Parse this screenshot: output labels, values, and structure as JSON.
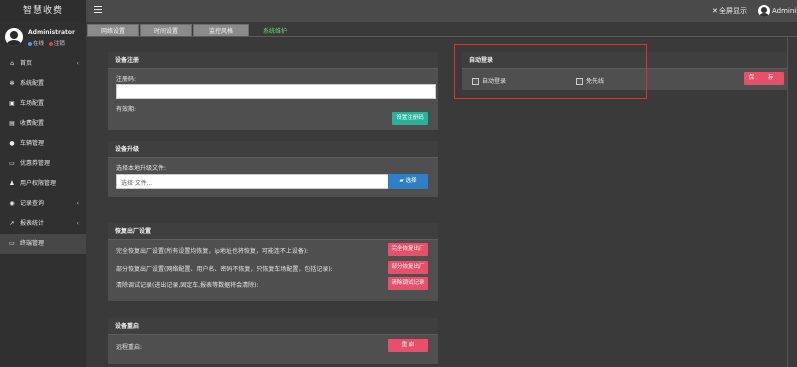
{
  "topbar": {
    "brand": "智慧收费",
    "fullscreen_label": "全屏显示",
    "user_name": "Adminis"
  },
  "sidebar": {
    "user_name": "Administrator",
    "status_online": "在线",
    "status_logout": "注销",
    "items": [
      {
        "label": "首页",
        "icon": "home-icon",
        "chevron": "‹"
      },
      {
        "label": "系统配置",
        "icon": "gear-icon",
        "chevron": ""
      },
      {
        "label": "车场配置",
        "icon": "parking-icon",
        "chevron": ""
      },
      {
        "label": "收费配置",
        "icon": "money-icon",
        "chevron": ""
      },
      {
        "label": "车辆管理",
        "icon": "car-icon",
        "chevron": ""
      },
      {
        "label": "优惠券管理",
        "icon": "coupon-icon",
        "chevron": ""
      },
      {
        "label": "用户权限管理",
        "icon": "users-icon",
        "chevron": ""
      },
      {
        "label": "记录查询",
        "icon": "search-icon",
        "chevron": "‹"
      },
      {
        "label": "报表统计",
        "icon": "chart-icon",
        "chevron": "‹"
      },
      {
        "label": "终端管理",
        "icon": "monitor-icon",
        "chevron": ""
      }
    ]
  },
  "tabs": [
    "网络设置",
    "时间设置",
    "监控风格",
    "系统维护"
  ],
  "register": {
    "title": "设备注册",
    "code_label": "注册码:",
    "code_value": "",
    "validity_label": "有效期:",
    "button": "设置注册码"
  },
  "upgrade": {
    "title": "设备升级",
    "file_label": "选择本地升级文件:",
    "file_placeholder": "选择 文件...",
    "browse_button": "选择"
  },
  "factory": {
    "title": "恢复出厂设置",
    "rows": [
      {
        "text": "完全恢复出厂设置(所有设置均恢复，ip地址也将恢复，可能连不上设备):",
        "button": "完全恢复出厂"
      },
      {
        "text": "部分恢复出厂设置(网络配置、用户名、密码不恢复，只恢复车场配置，包括记录):",
        "button": "部分恢复出厂"
      },
      {
        "text": "清除调试记录(进出记录,固定车,报表等数据将会清除):",
        "button": "清除调试记录"
      }
    ]
  },
  "restart": {
    "title": "设备重启",
    "label": "远程重启:",
    "button": "重 启"
  },
  "autologin": {
    "title": "自动登录",
    "option1": "自动登录",
    "option2": "免先线",
    "save": "保 存"
  },
  "colors": {
    "accent_teal": "#25b39a",
    "accent_blue": "#2f7fc6",
    "accent_red": "#e8506a",
    "active_tab": "#6fd26f"
  }
}
